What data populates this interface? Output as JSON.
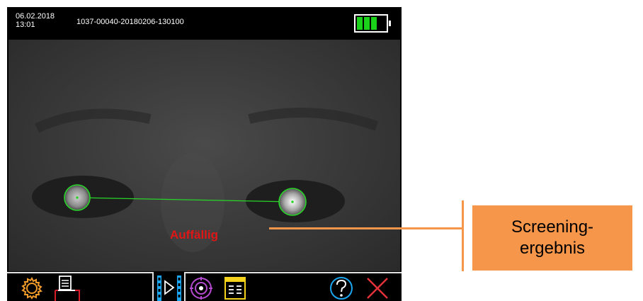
{
  "status_bar": {
    "date": "06.02.2018",
    "time": "13:01",
    "record_id": "1037-00040-20180206-130100",
    "battery_icon": "battery-full-icon",
    "battery_level": 1.0,
    "battery_color": "#1bd21b"
  },
  "camera_view": {
    "result_label": "Auffällig",
    "result_color": "#e01616",
    "tracking_color": "#28d628"
  },
  "toolbar": {
    "icons": [
      "gear-icon",
      "print-icon",
      "video-play-icon",
      "target-icon",
      "report-icon",
      "help-icon",
      "close-icon"
    ],
    "active_tab": "video-play-icon"
  },
  "callout": {
    "line1": "Screening-",
    "line2": "ergebnis",
    "color": "#f6964a"
  }
}
